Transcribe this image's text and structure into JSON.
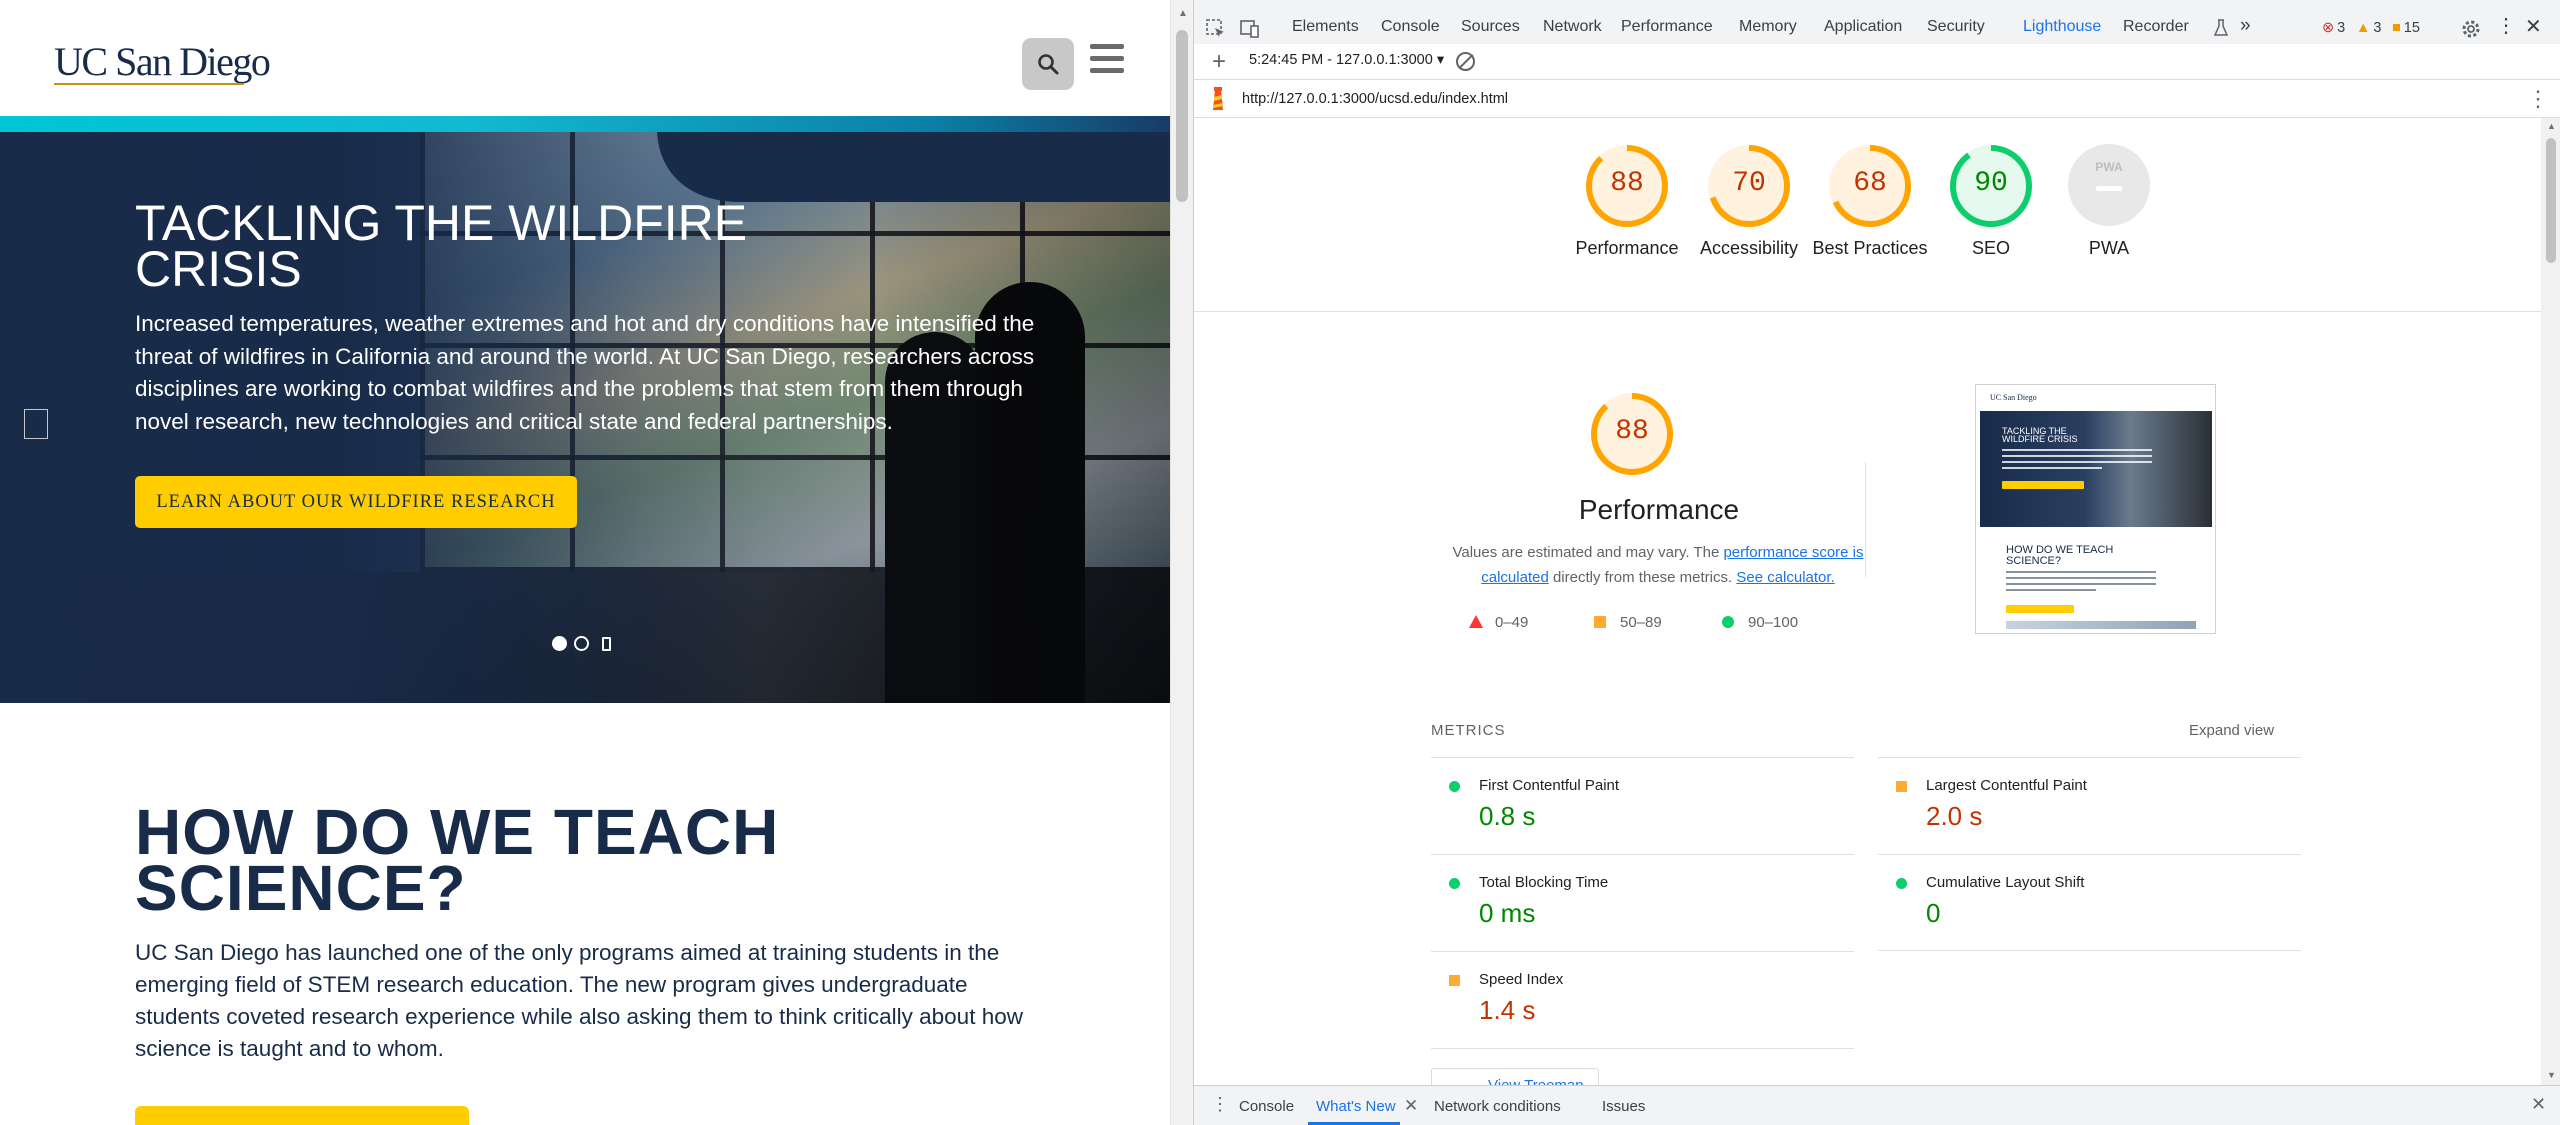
{
  "site": {
    "logo": "UC San Diego",
    "hero": {
      "title": "TACKLING THE WILDFIRE CRISIS",
      "text": "Increased temperatures, weather extremes and hot and dry conditions have intensified the threat of wildfires in California and around the world. At UC San Diego, researchers across disciplines are working to combat wildfires and the problems that stem from them through novel research, new technologies and critical state and federal partnerships.",
      "cta": "LEARN ABOUT OUR WILDFIRE RESEARCH"
    },
    "section2": {
      "title": "HOW DO WE TEACH SCIENCE?",
      "text": "UC San Diego has launched one of the only programs aimed at training students in the emerging field of STEM research education. The new program gives undergraduate students coveted research experience while also asking them to think critically about how science is taught and to whom."
    }
  },
  "devtools": {
    "tabs": [
      "Elements",
      "Console",
      "Sources",
      "Network",
      "Performance",
      "Memory",
      "Application",
      "Security",
      "Lighthouse",
      "Recorder"
    ],
    "active_tab": "Lighthouse",
    "errors": "3",
    "warnings": "3",
    "issues": "15",
    "run_select": "5:24:45 PM - 127.0.0.1:3000 ▾",
    "report_url": "http://127.0.0.1:3000/ucsd.edu/index.html",
    "gauges": [
      {
        "label": "Performance",
        "score": 88,
        "status": "average"
      },
      {
        "label": "Accessibility",
        "score": 70,
        "status": "average"
      },
      {
        "label": "Best Practices",
        "score": 68,
        "status": "average"
      },
      {
        "label": "SEO",
        "score": 90,
        "status": "pass"
      }
    ],
    "pwa": {
      "label": "PWA",
      "badge_text": "PWA"
    },
    "performance": {
      "score": "88",
      "title": "Performance",
      "desc_prefix": "Values are estimated and may vary. The ",
      "desc_link1": "performance score is calculated",
      "desc_middle": " directly from these metrics. ",
      "desc_link2": "See calculator."
    },
    "legend": {
      "fail": "0–49",
      "average": "50–89",
      "pass": "90–100"
    },
    "metrics_header": "METRICS",
    "expand_view": "Expand view",
    "metrics": [
      {
        "name": "First Contentful Paint",
        "value": "0.8 s",
        "status": "pass"
      },
      {
        "name": "Largest Contentful Paint",
        "value": "2.0 s",
        "status": "average"
      },
      {
        "name": "Total Blocking Time",
        "value": "0 ms",
        "status": "pass"
      },
      {
        "name": "Cumulative Layout Shift",
        "value": "0",
        "status": "pass"
      },
      {
        "name": "Speed Index",
        "value": "1.4 s",
        "status": "average"
      }
    ],
    "view_treemap": "View Treemap",
    "screenshot_preview": {
      "logo": "UC San Diego",
      "hero_title": "TACKLING THE WILDFIRE CRISIS",
      "section_title": "HOW DO WE TEACH SCIENCE?"
    },
    "drawer_tabs": [
      "Console",
      "What's New",
      "Network conditions",
      "Issues"
    ],
    "drawer_active": "What's New"
  },
  "colors": {
    "ucsd_navy": "#182b49",
    "ucsd_gold": "#ffcd00",
    "teal": "#00c6d7",
    "score_average": "#ffa400",
    "score_pass": "#0cce6b",
    "devtools_blue": "#1a73e8"
  }
}
